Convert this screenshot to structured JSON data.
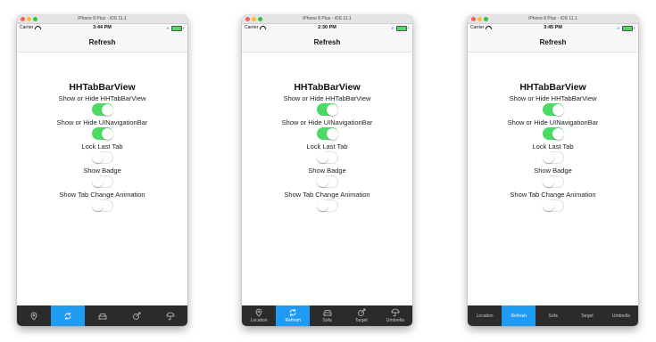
{
  "window_title": "iPhone 8 Plus - iOS 11.1",
  "carrier": "Carrier",
  "nav_title": "Refresh",
  "heading": "HHTabBarView",
  "accent": "#1e9bf2",
  "switch_on_color": "#4cd964",
  "settings": [
    {
      "label": "Show or Hide HHTabBarView",
      "on": true
    },
    {
      "label": "Show or Hide UINavigationBar",
      "on": true
    },
    {
      "label": "Lock Last Tab",
      "on": false
    },
    {
      "label": "Show Badge",
      "on": false
    },
    {
      "label": "Show Tab Change Animation",
      "on": false
    }
  ],
  "simulators": [
    {
      "time": "3:44 PM",
      "tabs": [
        {
          "icon": "location-icon",
          "label": ""
        },
        {
          "icon": "refresh-icon",
          "label": ""
        },
        {
          "icon": "sofa-icon",
          "label": ""
        },
        {
          "icon": "target-icon",
          "label": ""
        },
        {
          "icon": "umbrella-icon",
          "label": ""
        }
      ]
    },
    {
      "time": "2:30 PM",
      "tabs": [
        {
          "icon": "location-icon",
          "label": "Location"
        },
        {
          "icon": "refresh-icon",
          "label": "Refresh"
        },
        {
          "icon": "sofa-icon",
          "label": "Sofa"
        },
        {
          "icon": "target-icon",
          "label": "Target"
        },
        {
          "icon": "umbrella-icon",
          "label": "Umbrella"
        }
      ]
    },
    {
      "time": "3:45 PM",
      "tabs": [
        {
          "icon": "",
          "label": "Location"
        },
        {
          "icon": "",
          "label": "Refresh"
        },
        {
          "icon": "",
          "label": "Sofa"
        },
        {
          "icon": "",
          "label": "Target"
        },
        {
          "icon": "",
          "label": "Umbrella"
        }
      ]
    }
  ],
  "selected_tab_index": 1
}
